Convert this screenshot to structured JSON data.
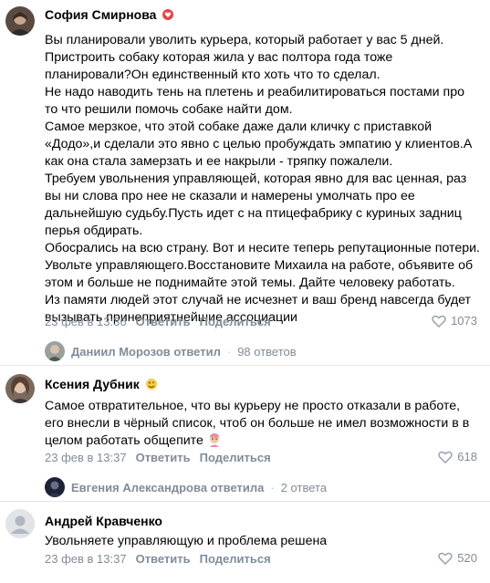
{
  "comments": [
    {
      "author": "София Смирнова",
      "lines": [
        "Вы планировали уволить курьера, который работает у вас 5 дней.",
        "Пристроить собаку которая жила у вас полтора года тоже",
        "планировали?Он единственный кто хоть что то сделал.",
        "Не надо наводить тень на плетень и реабилитироваться постами про",
        "то что решили помочь собаке найти дом.",
        "Самое мерзкое, что этой собаке даже дали кличку с приставкой",
        "«Додо»,и сделали это явно с целью пробуждать эмпатию у клиентов.А",
        "как она стала замерзать и ее накрыли - тряпку пожалели.",
        "Требуем увольнения управляющей, которая явно для вас ценная, раз",
        "вы ни слова про нее не сказали и намерены умолчать про ее",
        "дальнейшую судьбу.Пусть идет с на птицефабрику с куриных задниц",
        "перья обдирать.",
        "Обосрались на всю страну. Вот и несите теперь репутационные потери.",
        "Увольте управляющего.Восстановите Михаила на работе, объявите об",
        "этом и больше не поднимайте этой темы. Дайте человеку работать.",
        "Из памяти людей этот случай не исчезнет и ваш бренд навсегда будет",
        "вызывать принеприятнейшие ассоциации"
      ],
      "date": "23 фев в 13:36",
      "reply_label": "Ответить",
      "share_label": "Поделиться",
      "likes": "1073",
      "replies": {
        "name": "Даниил Морозов ответил",
        "count": "98 ответов"
      }
    },
    {
      "author": "Ксения Дубник",
      "lines": [
        "Самое отвратительное, что вы курьеру не просто отказали в работе,",
        "его внесли в чёрный список, чтоб он больше не имел возможности в в",
        "целом работать общепите"
      ],
      "date": "23 фев в 13:37",
      "reply_label": "Ответить",
      "share_label": "Поделиться",
      "likes": "618",
      "replies": {
        "name": "Евгения Александрова ответила",
        "count": "2 ответа"
      }
    },
    {
      "author": "Андрей Кравченко",
      "lines": [
        "Увольняете управляющую и проблема решена"
      ],
      "date": "23 фев в 13:37",
      "reply_label": "Ответить",
      "share_label": "Поделиться",
      "likes": "520"
    }
  ],
  "colors": {
    "meta": "#818c99",
    "divider": "#e7e8ec"
  }
}
